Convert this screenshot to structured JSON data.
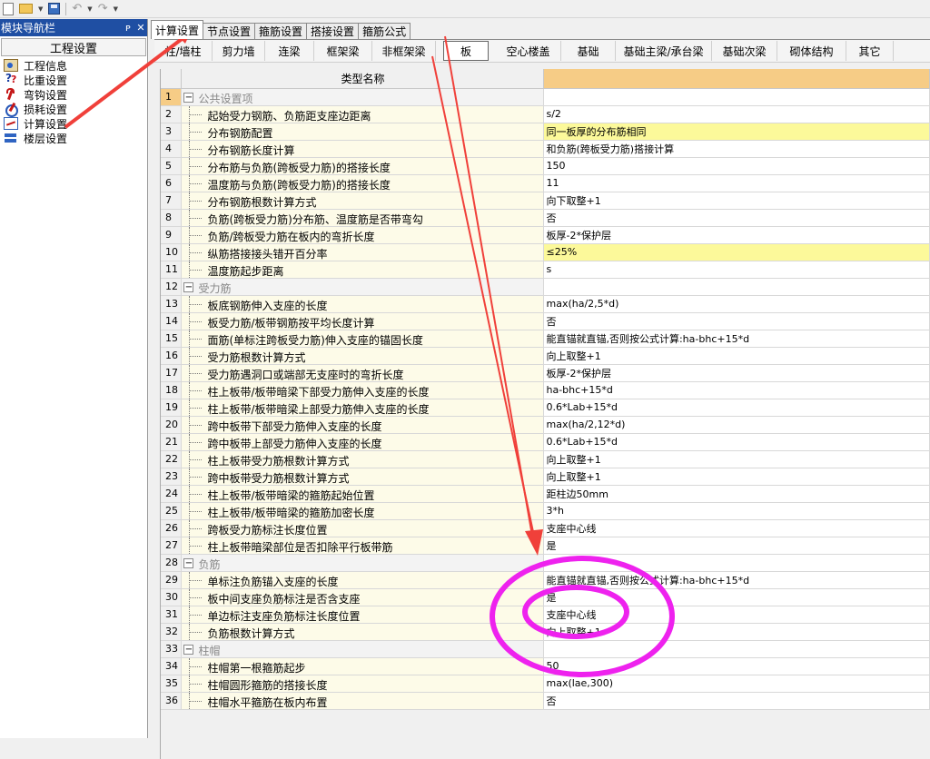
{
  "toolbar": {
    "icons": [
      "new-document-icon",
      "open-folder-icon",
      "save-icon",
      "undo-icon",
      "redo-icon"
    ]
  },
  "nav": {
    "title": "模块导航栏",
    "pin_glyph": "ꟷ",
    "close_glyph": "✕",
    "section": "工程设置",
    "items": [
      {
        "label": "工程信息",
        "icon": "project-info-icon"
      },
      {
        "label": "比重设置",
        "icon": "weight-ratio-icon"
      },
      {
        "label": "弯钩设置",
        "icon": "hook-icon"
      },
      {
        "label": "损耗设置",
        "icon": "loss-icon"
      },
      {
        "label": "计算设置",
        "icon": "calculation-icon"
      },
      {
        "label": "楼层设置",
        "icon": "floor-icon"
      }
    ]
  },
  "tabs": [
    "计算设置",
    "节点设置",
    "箍筋设置",
    "搭接设置",
    "箍筋公式"
  ],
  "subtabs": [
    "柱/墙柱",
    "剪力墙",
    "连梁",
    "框架梁",
    "非框架梁",
    "板",
    "空心楼盖",
    "基础",
    "基础主梁/承台梁",
    "基础次梁",
    "砌体结构",
    "其它"
  ],
  "grid": {
    "header": "类型名称",
    "rows": [
      {
        "n": "1",
        "name": "公共设置项",
        "value": "",
        "section": true
      },
      {
        "n": "2",
        "name": "起始受力钢筋、负筋距支座边距离",
        "value": "s/2"
      },
      {
        "n": "3",
        "name": "分布钢筋配置",
        "value": "同一板厚的分布筋相同",
        "yellow": true
      },
      {
        "n": "4",
        "name": "分布钢筋长度计算",
        "value": "和负筋(跨板受力筋)搭接计算"
      },
      {
        "n": "5",
        "name": "分布筋与负筋(跨板受力筋)的搭接长度",
        "value": "150"
      },
      {
        "n": "6",
        "name": "温度筋与负筋(跨板受力筋)的搭接长度",
        "value": "11"
      },
      {
        "n": "7",
        "name": "分布钢筋根数计算方式",
        "value": "向下取整+1"
      },
      {
        "n": "8",
        "name": "负筋(跨板受力筋)分布筋、温度筋是否带弯勾",
        "value": "否"
      },
      {
        "n": "9",
        "name": "负筋/跨板受力筋在板内的弯折长度",
        "value": "板厚-2*保护层"
      },
      {
        "n": "10",
        "name": "纵筋搭接接头错开百分率",
        "value": "≤25%",
        "yellow": true
      },
      {
        "n": "11",
        "name": "温度筋起步距离",
        "value": "s"
      },
      {
        "n": "12",
        "name": "受力筋",
        "value": "",
        "section": true
      },
      {
        "n": "13",
        "name": "板底钢筋伸入支座的长度",
        "value": "max(ha/2,5*d)"
      },
      {
        "n": "14",
        "name": "板受力筋/板带钢筋按平均长度计算",
        "value": "否"
      },
      {
        "n": "15",
        "name": "面筋(单标注跨板受力筋)伸入支座的锚固长度",
        "value": "能直锚就直锚,否则按公式计算:ha-bhc+15*d"
      },
      {
        "n": "16",
        "name": "受力筋根数计算方式",
        "value": "向上取整+1"
      },
      {
        "n": "17",
        "name": "受力筋遇洞口或端部无支座时的弯折长度",
        "value": "板厚-2*保护层"
      },
      {
        "n": "18",
        "name": "柱上板带/板带暗梁下部受力筋伸入支座的长度",
        "value": "ha-bhc+15*d"
      },
      {
        "n": "19",
        "name": "柱上板带/板带暗梁上部受力筋伸入支座的长度",
        "value": "0.6*Lab+15*d"
      },
      {
        "n": "20",
        "name": "跨中板带下部受力筋伸入支座的长度",
        "value": "max(ha/2,12*d)"
      },
      {
        "n": "21",
        "name": "跨中板带上部受力筋伸入支座的长度",
        "value": "0.6*Lab+15*d"
      },
      {
        "n": "22",
        "name": "柱上板带受力筋根数计算方式",
        "value": "向上取整+1"
      },
      {
        "n": "23",
        "name": "跨中板带受力筋根数计算方式",
        "value": "向上取整+1"
      },
      {
        "n": "24",
        "name": "柱上板带/板带暗梁的箍筋起始位置",
        "value": "距柱边50mm"
      },
      {
        "n": "25",
        "name": "柱上板带/板带暗梁的箍筋加密长度",
        "value": "3*h"
      },
      {
        "n": "26",
        "name": "跨板受力筋标注长度位置",
        "value": "支座中心线"
      },
      {
        "n": "27",
        "name": "柱上板带暗梁部位是否扣除平行板带筋",
        "value": "是"
      },
      {
        "n": "28",
        "name": "负筋",
        "value": "",
        "section": true
      },
      {
        "n": "29",
        "name": "单标注负筋锚入支座的长度",
        "value": "能直锚就直锚,否则按公式计算:ha-bhc+15*d"
      },
      {
        "n": "30",
        "name": "板中间支座负筋标注是否含支座",
        "value": "是"
      },
      {
        "n": "31",
        "name": "单边标注支座负筋标注长度位置",
        "value": "支座中心线"
      },
      {
        "n": "32",
        "name": "负筋根数计算方式",
        "value": "向上取整+1"
      },
      {
        "n": "33",
        "name": "柱帽",
        "value": "",
        "section": true
      },
      {
        "n": "34",
        "name": "柱帽第一根箍筋起步",
        "value": "50"
      },
      {
        "n": "35",
        "name": "柱帽圆形箍筋的搭接长度",
        "value": "max(lae,300)"
      },
      {
        "n": "36",
        "name": "柱帽水平箍筋在板内布置",
        "value": "否"
      }
    ]
  },
  "annotations": {
    "arrow_color": "#f0403a",
    "circle_color": "#ee22ee"
  }
}
